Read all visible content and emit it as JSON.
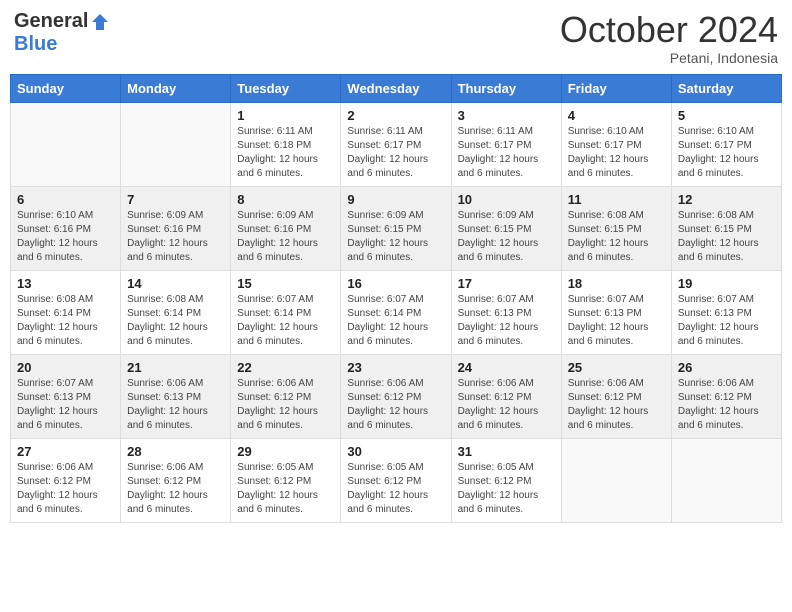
{
  "logo": {
    "general": "General",
    "blue": "Blue"
  },
  "header": {
    "month": "October 2024",
    "location": "Petani, Indonesia"
  },
  "days_of_week": [
    "Sunday",
    "Monday",
    "Tuesday",
    "Wednesday",
    "Thursday",
    "Friday",
    "Saturday"
  ],
  "weeks": [
    [
      {
        "day": "",
        "info": ""
      },
      {
        "day": "",
        "info": ""
      },
      {
        "day": "1",
        "info": "Sunrise: 6:11 AM\nSunset: 6:18 PM\nDaylight: 12 hours\nand 6 minutes."
      },
      {
        "day": "2",
        "info": "Sunrise: 6:11 AM\nSunset: 6:17 PM\nDaylight: 12 hours\nand 6 minutes."
      },
      {
        "day": "3",
        "info": "Sunrise: 6:11 AM\nSunset: 6:17 PM\nDaylight: 12 hours\nand 6 minutes."
      },
      {
        "day": "4",
        "info": "Sunrise: 6:10 AM\nSunset: 6:17 PM\nDaylight: 12 hours\nand 6 minutes."
      },
      {
        "day": "5",
        "info": "Sunrise: 6:10 AM\nSunset: 6:17 PM\nDaylight: 12 hours\nand 6 minutes."
      }
    ],
    [
      {
        "day": "6",
        "info": "Sunrise: 6:10 AM\nSunset: 6:16 PM\nDaylight: 12 hours\nand 6 minutes."
      },
      {
        "day": "7",
        "info": "Sunrise: 6:09 AM\nSunset: 6:16 PM\nDaylight: 12 hours\nand 6 minutes."
      },
      {
        "day": "8",
        "info": "Sunrise: 6:09 AM\nSunset: 6:16 PM\nDaylight: 12 hours\nand 6 minutes."
      },
      {
        "day": "9",
        "info": "Sunrise: 6:09 AM\nSunset: 6:15 PM\nDaylight: 12 hours\nand 6 minutes."
      },
      {
        "day": "10",
        "info": "Sunrise: 6:09 AM\nSunset: 6:15 PM\nDaylight: 12 hours\nand 6 minutes."
      },
      {
        "day": "11",
        "info": "Sunrise: 6:08 AM\nSunset: 6:15 PM\nDaylight: 12 hours\nand 6 minutes."
      },
      {
        "day": "12",
        "info": "Sunrise: 6:08 AM\nSunset: 6:15 PM\nDaylight: 12 hours\nand 6 minutes."
      }
    ],
    [
      {
        "day": "13",
        "info": "Sunrise: 6:08 AM\nSunset: 6:14 PM\nDaylight: 12 hours\nand 6 minutes."
      },
      {
        "day": "14",
        "info": "Sunrise: 6:08 AM\nSunset: 6:14 PM\nDaylight: 12 hours\nand 6 minutes."
      },
      {
        "day": "15",
        "info": "Sunrise: 6:07 AM\nSunset: 6:14 PM\nDaylight: 12 hours\nand 6 minutes."
      },
      {
        "day": "16",
        "info": "Sunrise: 6:07 AM\nSunset: 6:14 PM\nDaylight: 12 hours\nand 6 minutes."
      },
      {
        "day": "17",
        "info": "Sunrise: 6:07 AM\nSunset: 6:13 PM\nDaylight: 12 hours\nand 6 minutes."
      },
      {
        "day": "18",
        "info": "Sunrise: 6:07 AM\nSunset: 6:13 PM\nDaylight: 12 hours\nand 6 minutes."
      },
      {
        "day": "19",
        "info": "Sunrise: 6:07 AM\nSunset: 6:13 PM\nDaylight: 12 hours\nand 6 minutes."
      }
    ],
    [
      {
        "day": "20",
        "info": "Sunrise: 6:07 AM\nSunset: 6:13 PM\nDaylight: 12 hours\nand 6 minutes."
      },
      {
        "day": "21",
        "info": "Sunrise: 6:06 AM\nSunset: 6:13 PM\nDaylight: 12 hours\nand 6 minutes."
      },
      {
        "day": "22",
        "info": "Sunrise: 6:06 AM\nSunset: 6:12 PM\nDaylight: 12 hours\nand 6 minutes."
      },
      {
        "day": "23",
        "info": "Sunrise: 6:06 AM\nSunset: 6:12 PM\nDaylight: 12 hours\nand 6 minutes."
      },
      {
        "day": "24",
        "info": "Sunrise: 6:06 AM\nSunset: 6:12 PM\nDaylight: 12 hours\nand 6 minutes."
      },
      {
        "day": "25",
        "info": "Sunrise: 6:06 AM\nSunset: 6:12 PM\nDaylight: 12 hours\nand 6 minutes."
      },
      {
        "day": "26",
        "info": "Sunrise: 6:06 AM\nSunset: 6:12 PM\nDaylight: 12 hours\nand 6 minutes."
      }
    ],
    [
      {
        "day": "27",
        "info": "Sunrise: 6:06 AM\nSunset: 6:12 PM\nDaylight: 12 hours\nand 6 minutes."
      },
      {
        "day": "28",
        "info": "Sunrise: 6:06 AM\nSunset: 6:12 PM\nDaylight: 12 hours\nand 6 minutes."
      },
      {
        "day": "29",
        "info": "Sunrise: 6:05 AM\nSunset: 6:12 PM\nDaylight: 12 hours\nand 6 minutes."
      },
      {
        "day": "30",
        "info": "Sunrise: 6:05 AM\nSunset: 6:12 PM\nDaylight: 12 hours\nand 6 minutes."
      },
      {
        "day": "31",
        "info": "Sunrise: 6:05 AM\nSunset: 6:12 PM\nDaylight: 12 hours\nand 6 minutes."
      },
      {
        "day": "",
        "info": ""
      },
      {
        "day": "",
        "info": ""
      }
    ]
  ]
}
